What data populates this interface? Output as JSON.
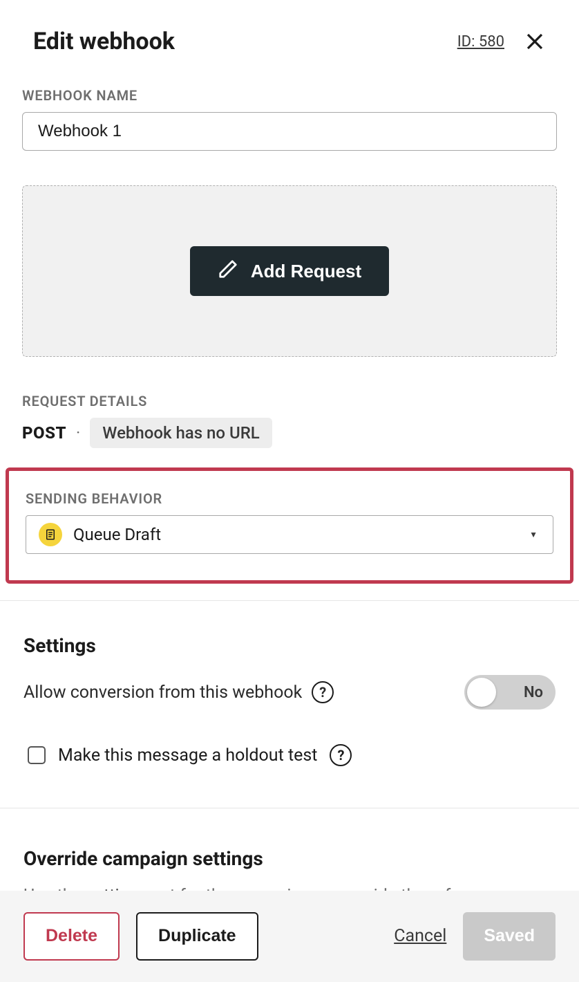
{
  "header": {
    "title": "Edit webhook",
    "id_label": "ID: 580"
  },
  "webhook_name": {
    "label": "WEBHOOK NAME",
    "value": "Webhook 1"
  },
  "add_request": {
    "button_label": "Add Request"
  },
  "request_details": {
    "label": "REQUEST DETAILS",
    "method": "POST",
    "url_tag": "Webhook has no URL"
  },
  "sending_behavior": {
    "label": "SENDING BEHAVIOR",
    "selected": "Queue Draft"
  },
  "settings": {
    "title": "Settings",
    "allow_conversion_label": "Allow conversion from this webhook",
    "allow_conversion_toggle": "No",
    "holdout_label": "Make this message a holdout test"
  },
  "override": {
    "title": "Override campaign settings",
    "text_prefix": "Use the ",
    "link": "settings",
    "text_suffix": " set for the campaign or override them for"
  },
  "footer": {
    "delete": "Delete",
    "duplicate": "Duplicate",
    "cancel": "Cancel",
    "saved": "Saved"
  }
}
